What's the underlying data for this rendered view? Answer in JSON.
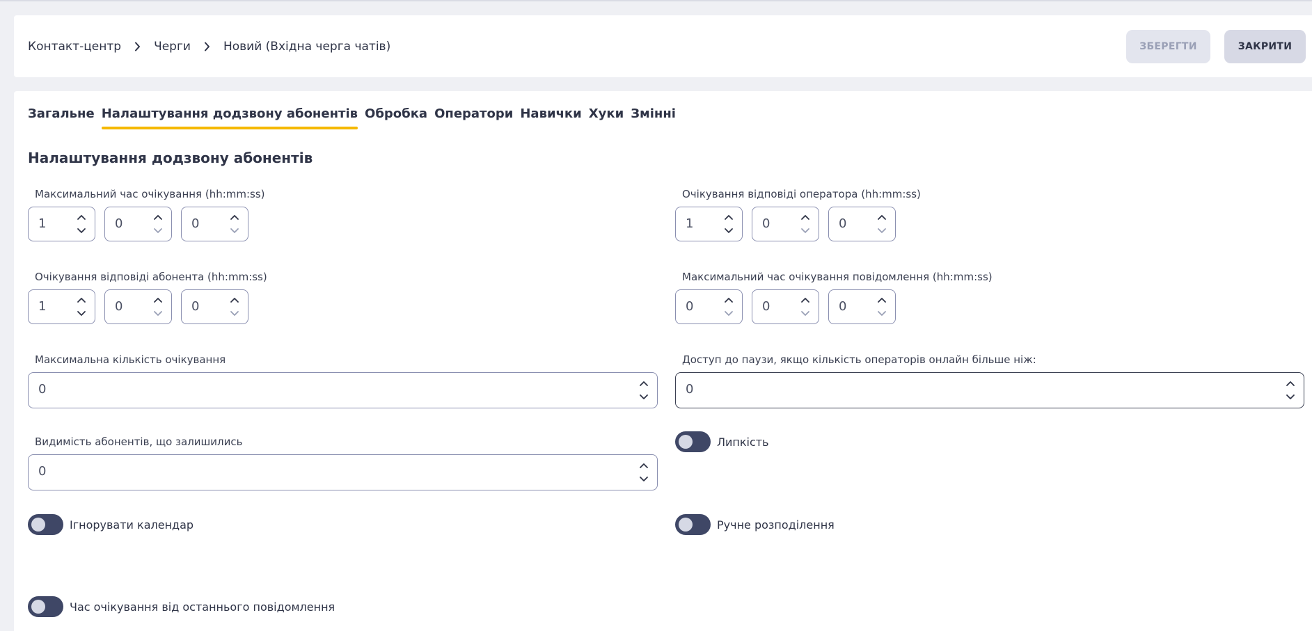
{
  "breadcrumb": [
    "Контакт-центр",
    "Черги",
    "Новий (Вхідна черга чатів)"
  ],
  "header": {
    "save_label": "ЗБЕРЕГТИ",
    "close_label": "ЗАКРИТИ"
  },
  "tabs": [
    "Загальне",
    "Налаштування додзвону абонентів",
    "Обробка",
    "Оператори",
    "Навички",
    "Хуки",
    "Змінні"
  ],
  "active_tab": "Налаштування додзвону абонентів",
  "section_title": "Налаштування додзвону абонентів",
  "fields": {
    "max_wait_time": {
      "label": "Максимальний час очікування (hh:mm:ss)",
      "values": [
        "1",
        "0",
        "0"
      ]
    },
    "operator_answer_wait": {
      "label": "Очікування відповіді оператора (hh:mm:ss)",
      "values": [
        "1",
        "0",
        "0"
      ]
    },
    "subscriber_answer_wait": {
      "label": "Очікування відповіді абонента (hh:mm:ss)",
      "values": [
        "1",
        "0",
        "0"
      ]
    },
    "max_message_wait": {
      "label": "Максимальний час очікування повідомлення (hh:mm:ss)",
      "values": [
        "0",
        "0",
        "0"
      ]
    },
    "max_waiting_count": {
      "label": "Максимальна кількість очікування",
      "value": "0"
    },
    "pause_access": {
      "label": "Доступ до паузи, якщо кількість операторів онлайн більше ніж:",
      "value": "0"
    },
    "remaining_visibility": {
      "label": "Видимість абонентів, що залишились",
      "value": "0"
    }
  },
  "toggles": {
    "stickiness": {
      "label": "Липкість",
      "on": false
    },
    "ignore_calendar": {
      "label": "Ігнорувати календар",
      "on": false
    },
    "manual_distribution": {
      "label": "Ручне розподілення",
      "on": false
    },
    "wait_from_last_message": {
      "label": "Час очікування від останнього повідомлення",
      "on": false
    }
  },
  "colors": {
    "accent": "#f5b800",
    "toggle_off": "#3f4766",
    "background": "#eff0f4"
  },
  "icons": [
    "chevron-right-icon",
    "chevron-up-icon",
    "chevron-down-icon"
  ]
}
